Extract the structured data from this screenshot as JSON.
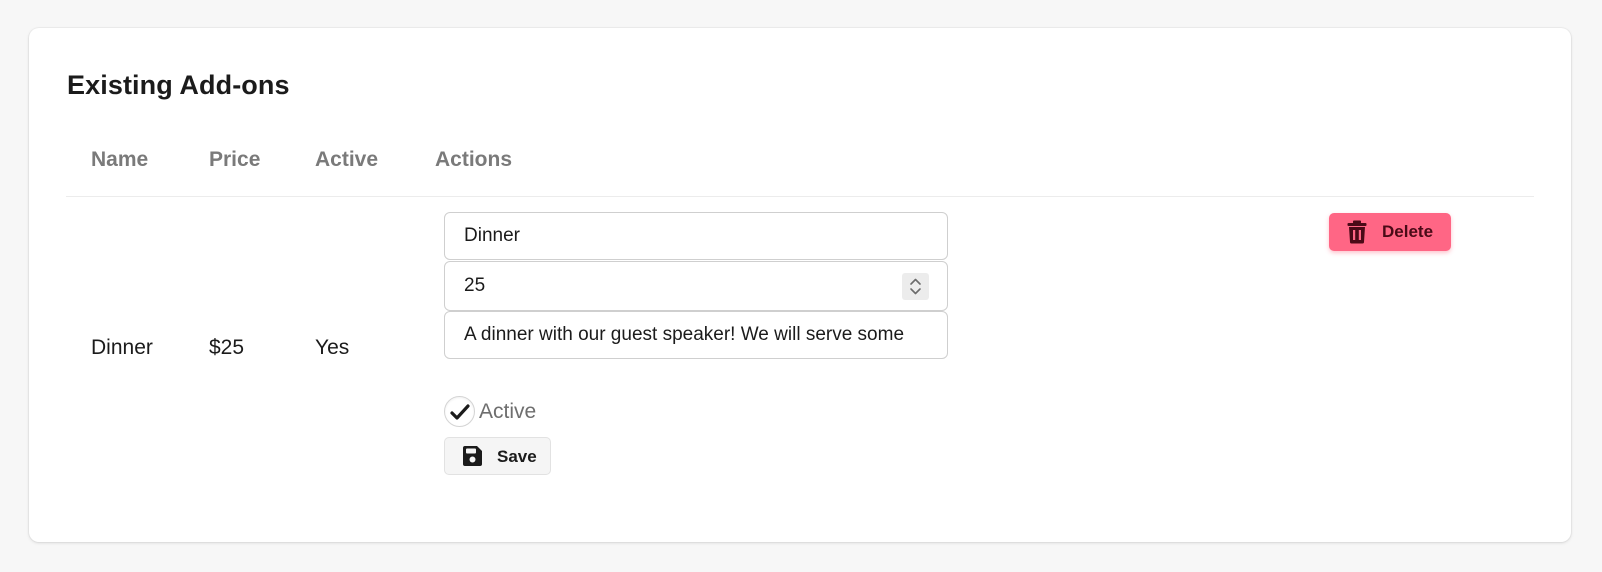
{
  "section": {
    "title": "Existing Add-ons"
  },
  "table": {
    "columns": [
      "Name",
      "Price",
      "Active",
      "Actions"
    ],
    "rows": [
      {
        "name": "Dinner",
        "price": "$25",
        "active": "Yes",
        "edit": {
          "name_value": "Dinner",
          "price_value": "25",
          "description_value": "A dinner with our guest speaker! We will serve some",
          "active_checked": true,
          "active_label": "Active",
          "save_label": "Save"
        },
        "delete_label": "Delete"
      }
    ]
  },
  "icons": {
    "checkbox": "checkmark-icon",
    "save": "floppy-disk-icon",
    "delete": "trash-icon",
    "spinner": "chevron-up-down-icon"
  },
  "colors": {
    "delete_bg": "#ff6685",
    "delete_text": "#4a0a17",
    "header_text": "#7a7a7a"
  }
}
